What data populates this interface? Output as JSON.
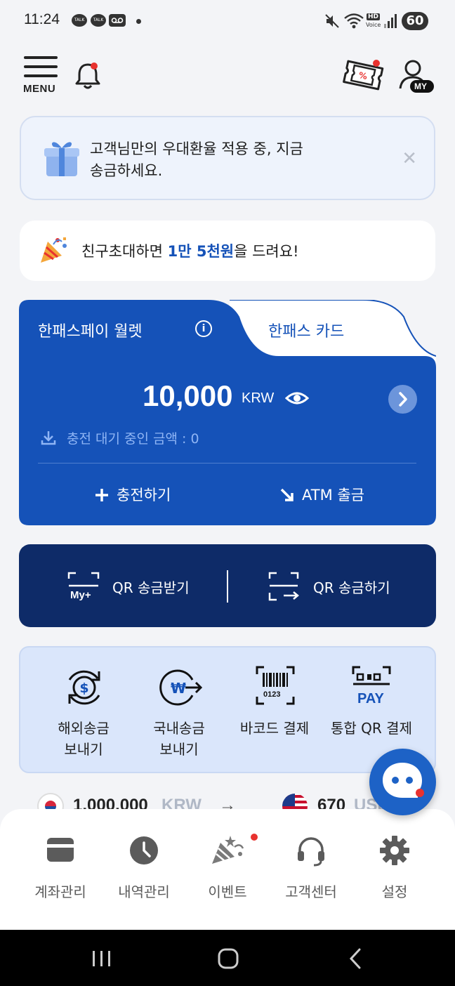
{
  "status_bar": {
    "time": "11:24",
    "talk_badge": "TALK",
    "battery": "60",
    "hd_label": "HD",
    "voice_label": "Voice"
  },
  "header": {
    "menu_label": "MENU",
    "my_label": "MY"
  },
  "notice": {
    "line1": "고객님만의 우대환율 적용 중, 지금",
    "line2": "송금하세요.",
    "close": "✕"
  },
  "invite": {
    "prefix": "친구초대하면 ",
    "highlight": "1만 5천원",
    "suffix": "을 드려요!"
  },
  "wallet": {
    "tab_wallet": "한패스페이 월렛",
    "info": "i",
    "tab_card": "한패스 카드",
    "balance": "10,000",
    "currency": "KRW",
    "pending": "충전 대기 중인 금액 : 0",
    "charge": "충전하기",
    "atm": "ATM 출금"
  },
  "qr": {
    "receive": "QR 송금받기",
    "send": "QR 송금하기",
    "my_plus": "My+"
  },
  "quick_menu": [
    {
      "line1": "해외송금",
      "line2": "보내기"
    },
    {
      "line1": "국내송금",
      "line2": "보내기"
    },
    {
      "line1": "바코드 결제",
      "line2": ""
    },
    {
      "line1": "통합 QR 결제",
      "line2": ""
    }
  ],
  "barcode_number": "0123",
  "pay_label": "PAY",
  "rates": {
    "krw": "1,000,000",
    "krw_unit": "KRW",
    "arrow": "→",
    "usd": "670",
    "usd_unit": "USD"
  },
  "bottom_nav": [
    {
      "label": "계좌관리"
    },
    {
      "label": "내역관리"
    },
    {
      "label": "이벤트"
    },
    {
      "label": "고객센터"
    },
    {
      "label": "설정"
    }
  ],
  "colors": {
    "primary": "#1552b8",
    "navy": "#0e2b68",
    "quick_bg": "#dae6fb",
    "alert_red": "#e8322f"
  }
}
